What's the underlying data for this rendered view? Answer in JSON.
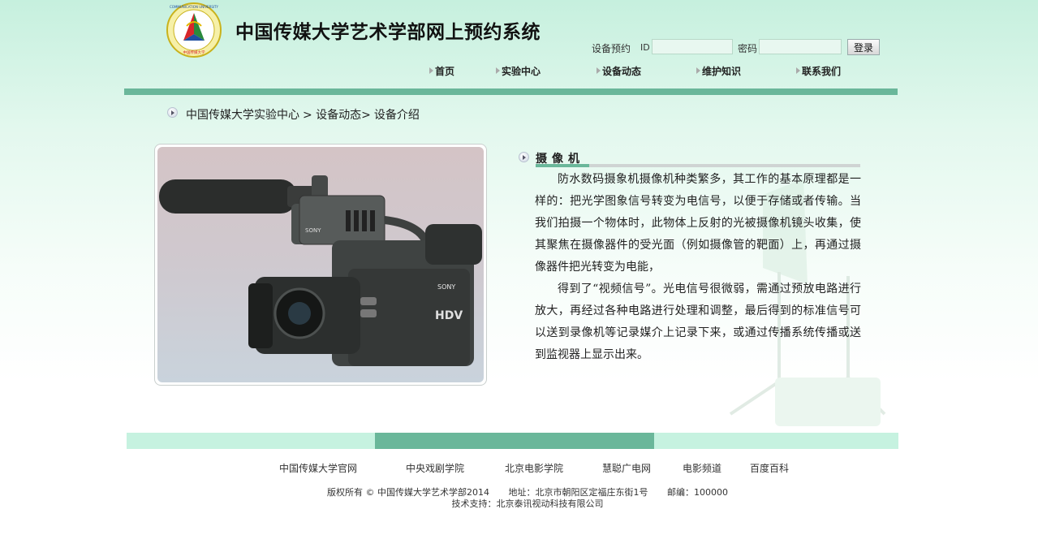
{
  "header": {
    "site_title": "中国传媒大学艺术学部网上预约系统",
    "logo_text_top": "COMMUNICATION UNIVERSITY",
    "logo_text_bottom": "中国传媒大学"
  },
  "login": {
    "label": "设备预约",
    "id_label": "ID",
    "password_label": "密码",
    "id_value": "",
    "password_value": "",
    "button_label": "登录"
  },
  "nav": {
    "items": [
      {
        "label": "首页"
      },
      {
        "label": "实验中心"
      },
      {
        "label": "设备动态"
      },
      {
        "label": "维护知识"
      },
      {
        "label": "联系我们"
      }
    ]
  },
  "breadcrumb": {
    "items": [
      "中国传媒大学实验中心",
      "> 设备动态>",
      "设备介绍"
    ]
  },
  "product": {
    "brand_label": "SONY",
    "model_label": "HDV"
  },
  "article": {
    "title": "摄像机",
    "paragraphs": [
      "防水数码摄象机摄像机种类繁多，其工作的基本原理都是一样的：把光学图象信号转变为电信号，以便于存储或者传输。当我们拍摄一个物体时，此物体上反射的光被摄像机镜头收集，使其聚焦在摄像器件的受光面（例如摄像管的靶面）上，再通过摄像器件把光转变为电能，",
      "得到了“视频信号”。光电信号很微弱，需通过预放电路进行放大，再经过各种电路进行处理和调整，最后得到的标准信号可以送到录像机等记录媒介上记录下来，或通过传播系统传播或送到监视器上显示出来。"
    ]
  },
  "footer": {
    "links": [
      {
        "label": "中国传媒大学官网"
      },
      {
        "label": "中央戏剧学院"
      },
      {
        "label": "北京电影学院"
      },
      {
        "label": "慧聪广电网"
      },
      {
        "label": "电影频道"
      },
      {
        "label": "百度百科"
      }
    ],
    "copyright": "版权所有 © 中国传媒大学艺术学部2014",
    "address": "地址：北京市朝阳区定福庄东街1号",
    "postcode": "邮编：100000",
    "support": "技术支持：北京泰讯视动科技有限公司"
  },
  "colors": {
    "accent_green": "#6ab79a",
    "light_green": "#c6f2e0"
  }
}
